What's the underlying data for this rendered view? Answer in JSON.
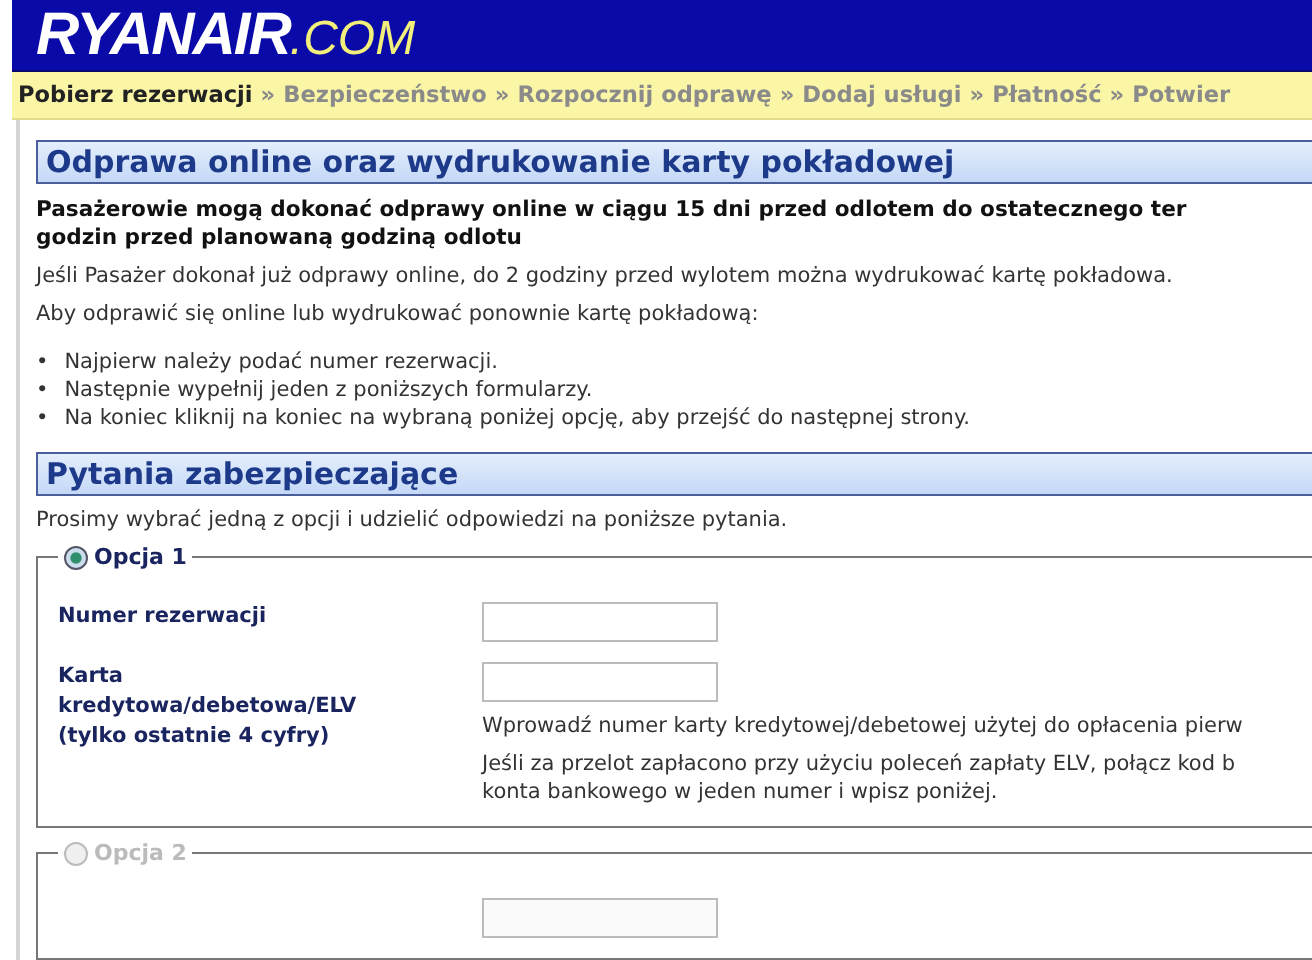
{
  "header": {
    "logo_main": "RYANAIR",
    "logo_suffix": ".COM"
  },
  "breadcrumb": [
    {
      "label": "Pobierz rezerwacji",
      "selected": true
    },
    {
      "label": "Bezpieczeństwo",
      "selected": false
    },
    {
      "label": "Rozpocznij odprawę",
      "selected": false
    },
    {
      "label": "Dodaj usługi",
      "selected": false
    },
    {
      "label": "Płatność",
      "selected": false
    },
    {
      "label": "Potwier",
      "selected": false
    }
  ],
  "breadcrumb_separator": "»",
  "checkin_section": {
    "title": "Odprawa online oraz wydrukowanie karty pokładowej",
    "intro_lines": [
      "Pasażerowie mogą dokonać odprawy online w ciągu 15 dni przed odlotem do ostatecznego ter",
      "godzin przed planowaną godziną odlotu"
    ],
    "paragraphs": [
      "Jeśli Pasażer dokonał już odprawy online, do 2 godziny przed wylotem można wydrukować kartę pokładowa.",
      "Aby odprawić się online lub wydrukować ponownie kartę pokładową:"
    ],
    "bullet": "•",
    "steps": [
      "Najpierw należy podać numer rezerwacji.",
      "Następnie wypełnij jeden z poniższych formularzy.",
      "Na koniec kliknij na koniec na wybraną poniżej opcję, aby przejść do następnej strony."
    ]
  },
  "security_section": {
    "title": "Pytania zabezpieczające",
    "instruction": "Prosimy wybrać jedną z opcji i udzielić odpowiedzi na poniższe pytania.",
    "options": [
      {
        "label": "Opcja 1",
        "selected": true,
        "disabled": false,
        "fields": [
          {
            "kind": "text-input",
            "label_lines": [
              "Numer rezerwacji"
            ]
          },
          {
            "kind": "text-input",
            "label_lines": [
              "Karta",
              "kredytowa/debetowa/ELV",
              "(tylko ostatnie 4 cyfry)"
            ],
            "help": [
              "Wprowadź numer karty kredytowej/debetowej użytej do opłacenia pierw",
              "Jeśli za przelot zapłacono przy użyciu poleceń zapłaty ELV, połącz kod b\nkonta bankowego w jeden numer i wpisz poniżej."
            ]
          }
        ]
      },
      {
        "label": "Opcja 2",
        "selected": false,
        "disabled": true,
        "fields": [
          {
            "kind": "text-input"
          }
        ]
      }
    ]
  }
}
